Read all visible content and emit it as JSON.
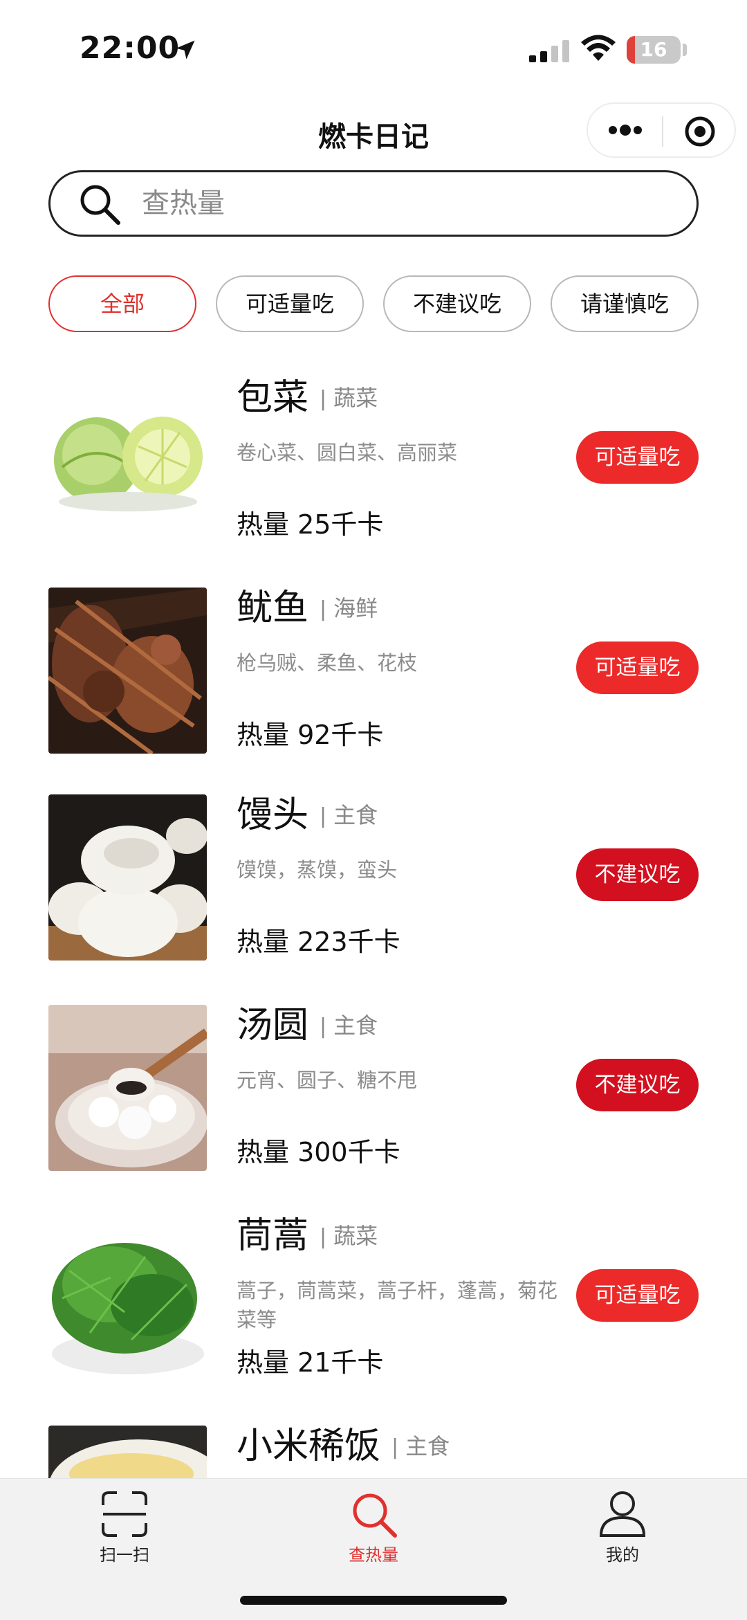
{
  "status_bar": {
    "time": "22:00",
    "battery": "16",
    "battery_level": 0.16
  },
  "nav": {
    "title": "燃卡日记"
  },
  "search": {
    "placeholder": "查热量"
  },
  "filters": [
    {
      "label": "全部",
      "active": true
    },
    {
      "label": "可适量吃",
      "active": false
    },
    {
      "label": "不建议吃",
      "active": false
    },
    {
      "label": "请谨慎吃",
      "active": false
    }
  ],
  "foods": [
    {
      "name": "包菜",
      "category": "蔬菜",
      "aliases": "卷心菜、圆白菜、高丽菜",
      "calories": "热量 25千卡",
      "badge": "可适量吃",
      "badge_type": "ok"
    },
    {
      "name": "鱿鱼",
      "category": "海鲜",
      "aliases": "枪乌贼、柔鱼、花枝",
      "calories": "热量 92千卡",
      "badge": "可适量吃",
      "badge_type": "ok"
    },
    {
      "name": "馒头",
      "category": "主食",
      "aliases": "馍馍，蒸馍，蛮头",
      "calories": "热量 223千卡",
      "badge": "不建议吃",
      "badge_type": "no"
    },
    {
      "name": "汤圆",
      "category": "主食",
      "aliases": "元宵、圆子、糖不甩",
      "calories": "热量 300千卡",
      "badge": "不建议吃",
      "badge_type": "no"
    },
    {
      "name": "茼蒿",
      "category": "蔬菜",
      "aliases": "蒿子，茼蒿菜，蒿子杆，蓬蒿，菊花菜等",
      "calories": "热量 21千卡",
      "badge": "可适量吃",
      "badge_type": "ok"
    },
    {
      "name": "小米稀饭",
      "category": "主食"
    }
  ],
  "tabbar": [
    {
      "label": "扫一扫",
      "icon": "scan-icon",
      "active": false
    },
    {
      "label": "查热量",
      "icon": "search-icon",
      "active": true
    },
    {
      "label": "我的",
      "icon": "user-icon",
      "active": false
    }
  ],
  "colors": {
    "accent": "#e0312f",
    "badge_ok": "#ec2a2a",
    "badge_no": "#d2101f"
  }
}
